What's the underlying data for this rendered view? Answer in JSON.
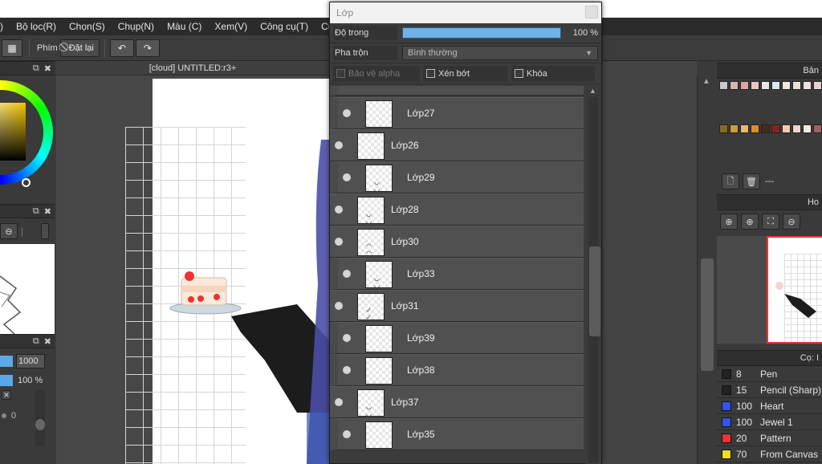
{
  "menu": [
    "Bộ lọc(R)",
    "Chọn(S)",
    "Chụp(N)",
    "Màu (C)",
    "Xem(V)",
    "Công cụ(T)",
    "Cử"
  ],
  "menu_lead": ")",
  "toolbar": {
    "phim_label": "Phím",
    "reset_label": "Đặt lại"
  },
  "canvas": {
    "title": "[cloud] UNTITLED:r3+"
  },
  "left_panel": {
    "brush_size": "1000",
    "brush_opacity": "100 %",
    "extra_value": "0"
  },
  "layer_dialog": {
    "title": "Lớp",
    "opacity_label": "Độ trong",
    "opacity_value": "100 %",
    "opacity_fraction": 1.0,
    "blend_label": "Pha trộn",
    "blend_value": "Bình thường",
    "checks": [
      {
        "label": "Bảo vệ alpha",
        "enabled": false
      },
      {
        "label": "Xén bớt",
        "enabled": true
      },
      {
        "label": "Khóa",
        "enabled": true
      }
    ],
    "layers": [
      {
        "name": "Lớp27",
        "indent": true
      },
      {
        "name": "Lớp26",
        "indent": false
      },
      {
        "name": "Lớp29",
        "indent": true
      },
      {
        "name": "Lớp28",
        "indent": false
      },
      {
        "name": "Lớp30",
        "indent": false
      },
      {
        "name": "Lớp33",
        "indent": true
      },
      {
        "name": "Lớp31",
        "indent": false
      },
      {
        "name": "Lớp39",
        "indent": true
      },
      {
        "name": "Lớp38",
        "indent": true
      },
      {
        "name": "Lớp37",
        "indent": false
      },
      {
        "name": "Lớp35",
        "indent": true
      }
    ]
  },
  "palette_panel": {
    "title": "Bản",
    "footer_dash": "---"
  },
  "navigator_panel": {
    "title": "Ho"
  },
  "brush_panel": {
    "title": "Cọ: I",
    "brushes": [
      {
        "size": "8",
        "name": "Pen",
        "color": "#222222"
      },
      {
        "size": "15",
        "name": "Pencil (Sharp)",
        "color": "#222222"
      },
      {
        "size": "100",
        "name": "Heart",
        "color": "#3355ee"
      },
      {
        "size": "100",
        "name": "Jewel 1",
        "color": "#3355ee"
      },
      {
        "size": "20",
        "name": "Pattern",
        "color": "#ee3333"
      },
      {
        "size": "70",
        "name": "From Canvas",
        "color": "#eedd22"
      }
    ]
  },
  "palette_colors": [
    "#c9c9c9",
    "#d6b6a8",
    "#d8a8a0",
    "#e8c8c0",
    "#e6e6e6",
    "#d8e8f0",
    "#f0e8d8",
    "#e8e0d0",
    "#f0e0e0",
    "#e8d0d0",
    "#f0f0f0",
    "#8a6a20",
    "#c8a040",
    "#e8b870",
    "#e08a30",
    "#4a2a1a",
    "#8a2020",
    "#f8c8b0",
    "#e8d8c8",
    "#f8e8e0",
    "#a06060",
    "#ffffff"
  ]
}
